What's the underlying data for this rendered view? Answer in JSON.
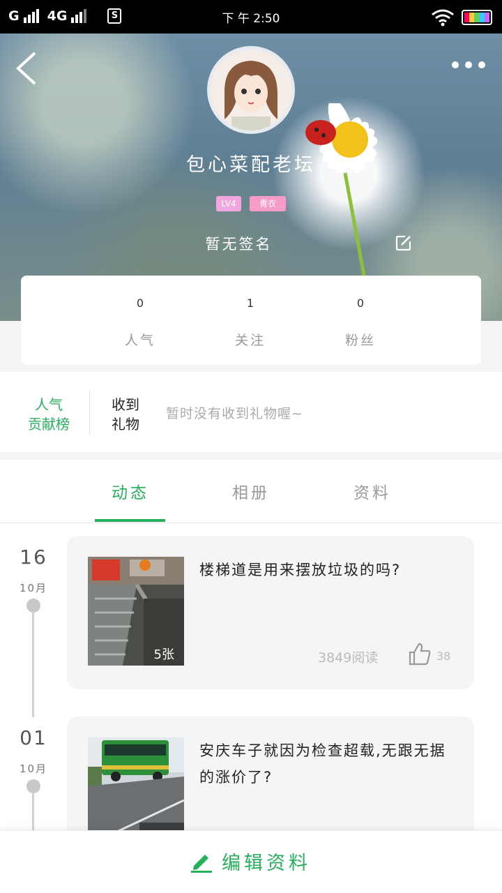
{
  "status_bar": {
    "carrier1": "G",
    "carrier2": "4G",
    "sim_icon": "S",
    "time": "下 午 2:50"
  },
  "profile": {
    "nickname": "包心菜配老坛",
    "badge_level": "LV4",
    "badge_title": "青衣",
    "signature": "暂无签名"
  },
  "stats": [
    {
      "value": "0",
      "label": "人气"
    },
    {
      "value": "1",
      "label": "关注"
    },
    {
      "value": "0",
      "label": "粉丝"
    }
  ],
  "gift": {
    "rank_label_1": "人气",
    "rank_label_2": "贡献榜",
    "received_1": "收到",
    "received_2": "礼物",
    "empty_text": "暂时没有收到礼物喔~"
  },
  "tabs": [
    {
      "label": "动态",
      "active": true
    },
    {
      "label": "相册",
      "active": false
    },
    {
      "label": "资料",
      "active": false
    }
  ],
  "posts": [
    {
      "day": "16",
      "month": "10月",
      "title": "楼梯道是用来摆放垃圾的吗?",
      "image_count": "5张",
      "reads": "3849阅读",
      "likes": "38"
    },
    {
      "day": "01",
      "month": "10月",
      "title": "安庆车子就因为检查超载,无跟无据的涨价了?"
    }
  ],
  "bottom": {
    "edit_label": "编辑资料"
  },
  "colors": {
    "accent": "#27b05c",
    "badge_pink": "#f79bc9"
  }
}
